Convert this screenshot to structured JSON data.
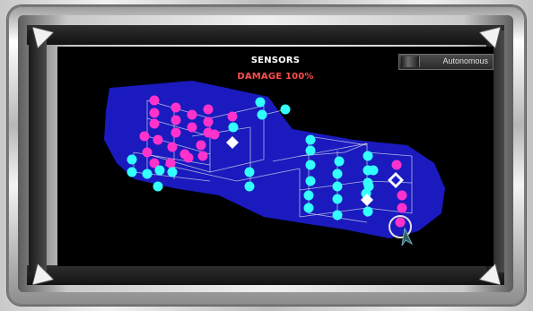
{
  "screen": {
    "title": "SENSORS",
    "damage": "DAMAGE 100%",
    "mode_button_label": "Autonomous"
  },
  "colors": {
    "hull_blue": "#1c1ccf",
    "grid_line": "#cfcfe8",
    "node_magenta": "#ff33cc",
    "node_cyan": "#33ffff",
    "marker_white": "#ffffff",
    "damage_text": "#ff4d4d"
  },
  "sensor_map": {
    "marker_icons": [
      "diamond-marker-icon",
      "diamond-marker-icon",
      "diamond-marker-icon",
      "target-reticle-icon",
      "cursor-arrow-icon"
    ]
  }
}
